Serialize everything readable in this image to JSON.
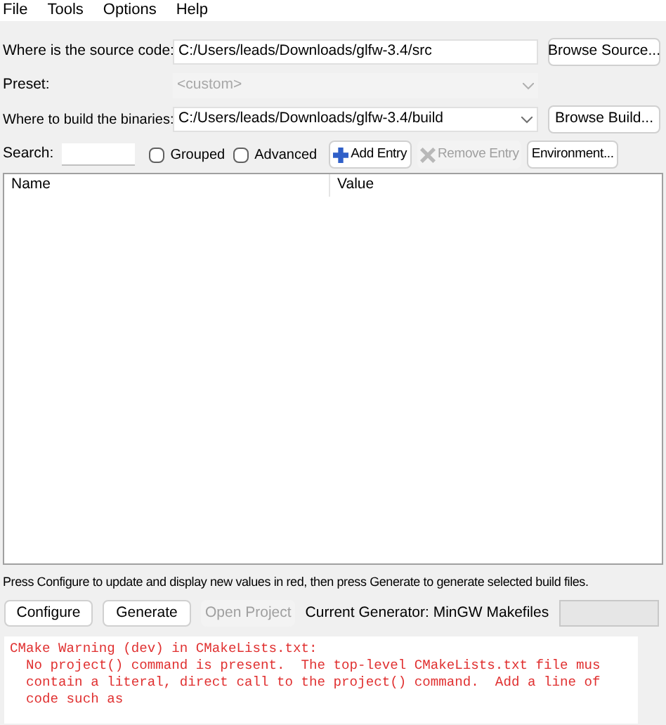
{
  "menu": [
    "File",
    "Tools",
    "Options",
    "Help"
  ],
  "source": {
    "label": "Where is the source code:",
    "value": "C:/Users/leads/Downloads/glfw-3.4/src",
    "button": "Browse Source..."
  },
  "preset": {
    "label": "Preset:",
    "value": "<custom>",
    "disabled": true
  },
  "build": {
    "label": "Where to build the binaries:",
    "value": "C:/Users/leads/Downloads/glfw-3.4/build",
    "button": "Browse Build..."
  },
  "search": {
    "label": "Search:"
  },
  "checkboxes": [
    {
      "label": "Grouped",
      "checked": false
    },
    {
      "label": "Advanced",
      "checked": false
    }
  ],
  "toolbar_buttons": [
    {
      "label": "Add Entry",
      "kind": "add",
      "disabled": false
    },
    {
      "label": "Remove Entry",
      "kind": "remove",
      "disabled": true
    },
    {
      "label": "Environment...",
      "kind": "plain",
      "disabled": false
    }
  ],
  "table": {
    "columns": [
      "Name",
      "Value"
    ]
  },
  "hint": "Press Configure to update and display new values in red, then press Generate to generate selected build files.",
  "actions": [
    {
      "label": "Configure",
      "disabled": false
    },
    {
      "label": "Generate",
      "disabled": false
    },
    {
      "label": "Open Project",
      "disabled": true
    }
  ],
  "generator": "Current Generator: MinGW Makefiles",
  "progress": {
    "level": 0
  },
  "log": [
    "CMake Warning (dev) in CMakeLists.txt:",
    "  No project() command is present.  The top-level CMakeLists.txt file mus",
    "  contain a literal, direct call to the project() command.  Add a line of",
    "  code such as"
  ]
}
